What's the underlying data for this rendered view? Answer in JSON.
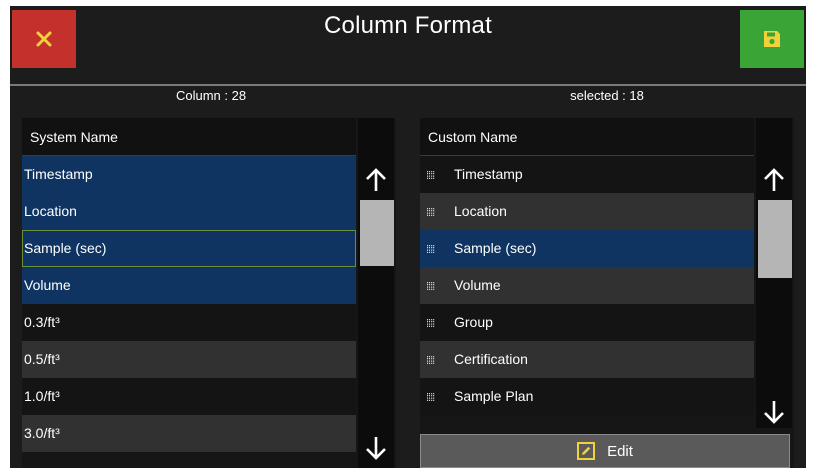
{
  "header": {
    "title": "Column Format",
    "close_icon": "close-icon",
    "save_icon": "floppy-disk-icon",
    "colors": {
      "close": "#c4302b",
      "save": "#3aa536",
      "close_glyph": "#f2d23b"
    }
  },
  "left_panel": {
    "count_label": "Column : 28",
    "header": "System Name",
    "rows": [
      {
        "label": "Timestamp",
        "state": "selected"
      },
      {
        "label": "Location",
        "state": "selected"
      },
      {
        "label": "Sample (sec)",
        "state": "selected-focused"
      },
      {
        "label": "Volume",
        "state": "selected"
      },
      {
        "label": "0.3/ft³",
        "state": "normal"
      },
      {
        "label": "0.5/ft³",
        "state": "normal"
      },
      {
        "label": "1.0/ft³",
        "state": "normal"
      },
      {
        "label": "3.0/ft³",
        "state": "normal"
      }
    ]
  },
  "right_panel": {
    "count_label": "selected : 18",
    "header": "Custom Name",
    "rows": [
      {
        "label": "Timestamp",
        "state": "normal"
      },
      {
        "label": "Location",
        "state": "normal"
      },
      {
        "label": "Sample (sec)",
        "state": "selected"
      },
      {
        "label": "Volume",
        "state": "normal"
      },
      {
        "label": "Group",
        "state": "normal"
      },
      {
        "label": "Certification",
        "state": "normal"
      },
      {
        "label": "Sample Plan",
        "state": "normal"
      }
    ],
    "edit_label": "Edit",
    "edit_icon": "edit-icon",
    "grip_icon": "drag-handle-icon"
  },
  "colors": {
    "background": "#1c1c1c",
    "selected_row": "#0f3462",
    "alt_row": "#313131",
    "scroll_thumb": "#b5b5b5"
  }
}
